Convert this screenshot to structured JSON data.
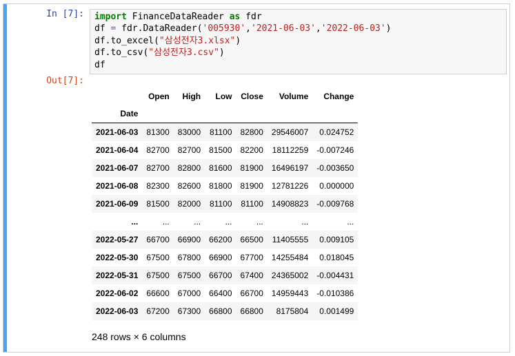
{
  "cell": {
    "in_prompt": "In [7]:",
    "out_prompt": "Out[7]:",
    "code_lines": [
      [
        {
          "t": "import",
          "c": "kw"
        },
        {
          "t": " FinanceDataReader ",
          "c": ""
        },
        {
          "t": "as",
          "c": "kw"
        },
        {
          "t": " fdr",
          "c": ""
        }
      ],
      [
        {
          "t": "df ",
          "c": ""
        },
        {
          "t": "=",
          "c": "op"
        },
        {
          "t": " fdr.DataReader(",
          "c": ""
        },
        {
          "t": "'005930'",
          "c": "str"
        },
        {
          "t": ",",
          "c": ""
        },
        {
          "t": "'2021-06-03'",
          "c": "str"
        },
        {
          "t": ",",
          "c": ""
        },
        {
          "t": "'2022-06-03'",
          "c": "str"
        },
        {
          "t": ")",
          "c": ""
        }
      ],
      [
        {
          "t": "df.to_excel(",
          "c": ""
        },
        {
          "t": "\"삼성전자3.xlsx\"",
          "c": "str"
        },
        {
          "t": ")",
          "c": ""
        }
      ],
      [
        {
          "t": "df.to_csv(",
          "c": ""
        },
        {
          "t": "\"삼성전자3.csv\"",
          "c": "str"
        },
        {
          "t": ")",
          "c": ""
        }
      ],
      [
        {
          "t": "df",
          "c": ""
        }
      ]
    ]
  },
  "dataframe": {
    "columns": [
      "Open",
      "High",
      "Low",
      "Close",
      "Volume",
      "Change"
    ],
    "index_name": "Date",
    "rows": [
      {
        "index": "2021-06-03",
        "values": [
          "81300",
          "83000",
          "81100",
          "82800",
          "29546007",
          "0.024752"
        ]
      },
      {
        "index": "2021-06-04",
        "values": [
          "82700",
          "82700",
          "81500",
          "82200",
          "18112259",
          "-0.007246"
        ]
      },
      {
        "index": "2021-06-07",
        "values": [
          "82700",
          "82800",
          "81600",
          "81900",
          "16496197",
          "-0.003650"
        ]
      },
      {
        "index": "2021-06-08",
        "values": [
          "82300",
          "82600",
          "81800",
          "81900",
          "12781226",
          "0.000000"
        ]
      },
      {
        "index": "2021-06-09",
        "values": [
          "81500",
          "82000",
          "81100",
          "81100",
          "14908823",
          "-0.009768"
        ]
      },
      {
        "index": "...",
        "values": [
          "...",
          "...",
          "...",
          "...",
          "...",
          "..."
        ]
      },
      {
        "index": "2022-05-27",
        "values": [
          "66700",
          "66900",
          "66200",
          "66500",
          "11405555",
          "0.009105"
        ]
      },
      {
        "index": "2022-05-30",
        "values": [
          "67500",
          "67800",
          "66900",
          "67700",
          "14255484",
          "0.018045"
        ]
      },
      {
        "index": "2022-05-31",
        "values": [
          "67500",
          "67500",
          "66700",
          "67400",
          "24365002",
          "-0.004431"
        ]
      },
      {
        "index": "2022-06-02",
        "values": [
          "66600",
          "67000",
          "66400",
          "66700",
          "14959443",
          "-0.010386"
        ]
      },
      {
        "index": "2022-06-03",
        "values": [
          "67200",
          "67300",
          "66800",
          "66800",
          "8175804",
          "0.001499"
        ]
      }
    ],
    "shape_text": "248 rows × 6 columns"
  },
  "colors": {
    "cell_bar": "#42a5f5",
    "in_prompt": "#303f9f",
    "out_prompt": "#d84315",
    "keyword": "#008000",
    "string": "#ba2121"
  }
}
